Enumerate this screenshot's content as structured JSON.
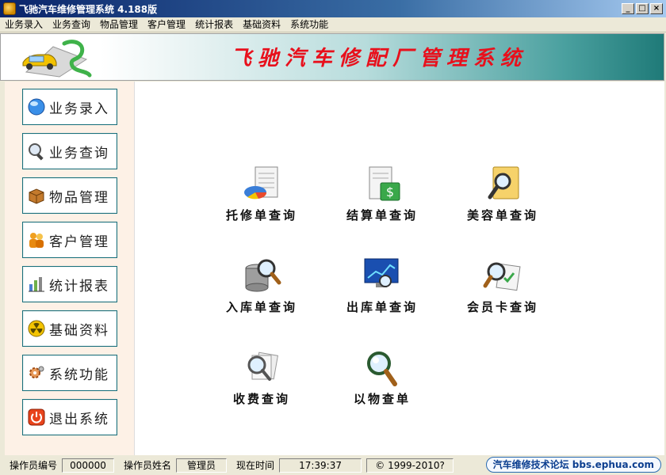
{
  "window": {
    "title": "飞驰汽车维修管理系统 4.188版",
    "controls": [
      "_",
      "□",
      "×"
    ]
  },
  "menu": [
    "业务录入",
    "业务查询",
    "物品管理",
    "客户管理",
    "统计报表",
    "基础资料",
    "系统功能"
  ],
  "banner": {
    "title": "飞驰汽车修配厂管理系统"
  },
  "sidebar": {
    "items": [
      {
        "label": "业务录入",
        "icon": "globe-icon"
      },
      {
        "label": "业务查询",
        "icon": "magnifier-icon"
      },
      {
        "label": "物品管理",
        "icon": "box-icon"
      },
      {
        "label": "客户管理",
        "icon": "people-icon"
      },
      {
        "label": "统计报表",
        "icon": "bar-chart-icon"
      },
      {
        "label": "基础资料",
        "icon": "radiation-icon"
      },
      {
        "label": "系统功能",
        "icon": "gears-icon"
      },
      {
        "label": "退出系统",
        "icon": "power-icon"
      }
    ]
  },
  "main": {
    "tiles": [
      {
        "label": "托修单查询",
        "icon": "document-pie-icon"
      },
      {
        "label": "结算单查询",
        "icon": "document-money-icon"
      },
      {
        "label": "美容单查询",
        "icon": "note-magnifier-icon"
      },
      {
        "label": "入库单查询",
        "icon": "database-magnifier-icon"
      },
      {
        "label": "出库单查询",
        "icon": "monitor-chart-icon"
      },
      {
        "label": "会员卡查询",
        "icon": "card-magnifier-icon"
      },
      {
        "label": "收费查询",
        "icon": "papers-magnifier-icon"
      },
      {
        "label": "以物查单",
        "icon": "magnifier-icon"
      }
    ]
  },
  "status": {
    "operator_id_label": "操作员编号",
    "operator_id": "000000",
    "operator_name_label": "操作员姓名",
    "operator_name": "管理员",
    "time_label": "现在时间",
    "time": "17:39:37",
    "copyright": "© 1999-2010?",
    "forum": "汽车维修技术论坛 bbs.ephua.com"
  },
  "colors": {
    "banner_title": "#e8101c",
    "nav_border": "#1a6f7c",
    "sidebar_bg": "#fdf1e6"
  }
}
